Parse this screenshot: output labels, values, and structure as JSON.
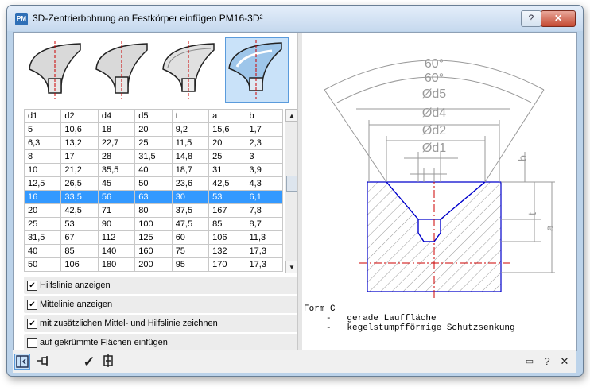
{
  "window": {
    "title": "3D-Zentrierbohrung an Festkörper einfügen  PM16-3D²",
    "app_icon_text": "PM",
    "help_glyph": "?",
    "close_glyph": "✕"
  },
  "table": {
    "headers": [
      "d1",
      "d2",
      "d4",
      "d5",
      "t",
      "a",
      "b"
    ],
    "rows": [
      [
        "5",
        "10,6",
        "18",
        "20",
        "9,2",
        "15,6",
        "1,7"
      ],
      [
        "6,3",
        "13,2",
        "22,7",
        "25",
        "11,5",
        "20",
        "2,3"
      ],
      [
        "8",
        "17",
        "28",
        "31,5",
        "14,8",
        "25",
        "3"
      ],
      [
        "10",
        "21,2",
        "35,5",
        "40",
        "18,7",
        "31",
        "3,9"
      ],
      [
        "12,5",
        "26,5",
        "45",
        "50",
        "23,6",
        "42,5",
        "4,3"
      ],
      [
        "16",
        "33,5",
        "56",
        "63",
        "30",
        "53",
        "6,1"
      ],
      [
        "20",
        "42,5",
        "71",
        "80",
        "37,5",
        "167",
        "7,8"
      ],
      [
        "25",
        "53",
        "90",
        "100",
        "47,5",
        "85",
        "8,7"
      ],
      [
        "31,5",
        "67",
        "112",
        "125",
        "60",
        "106",
        "11,3"
      ],
      [
        "40",
        "85",
        "140",
        "160",
        "75",
        "132",
        "17,3"
      ],
      [
        "50",
        "106",
        "180",
        "200",
        "95",
        "170",
        "17,3"
      ]
    ],
    "selected_row": 5
  },
  "checkboxes": [
    {
      "label": "Hilfslinie anzeigen",
      "checked": true
    },
    {
      "label": "Mittelinie anzeigen",
      "checked": true
    },
    {
      "label": "mit zusätzlichen Mittel- und Hilfslinie zeichnen",
      "checked": true
    },
    {
      "label": "auf gekrümmte Flächen einfügen",
      "checked": false
    }
  ],
  "check_mark": "✔",
  "drawing": {
    "dims": [
      "60°",
      "60°",
      "Ød5",
      "Ød4",
      "Ød2",
      "Ød1"
    ],
    "side_labels": [
      "b",
      "t",
      "a"
    ],
    "form_title": "Form C",
    "form_lines": [
      "-   gerade Lauffläche",
      "-   kegelstumpfförmige Schutzsenkung"
    ]
  },
  "bottom": {
    "ok_glyph": "✓",
    "help_glyph": "?",
    "min_glyph": "▭",
    "close_glyph": "✕"
  },
  "colors": {
    "selection": "#3399ff",
    "outline_blue": "#0000cc",
    "centerline_red": "#cc0000",
    "dimension_gray": "#999999"
  }
}
